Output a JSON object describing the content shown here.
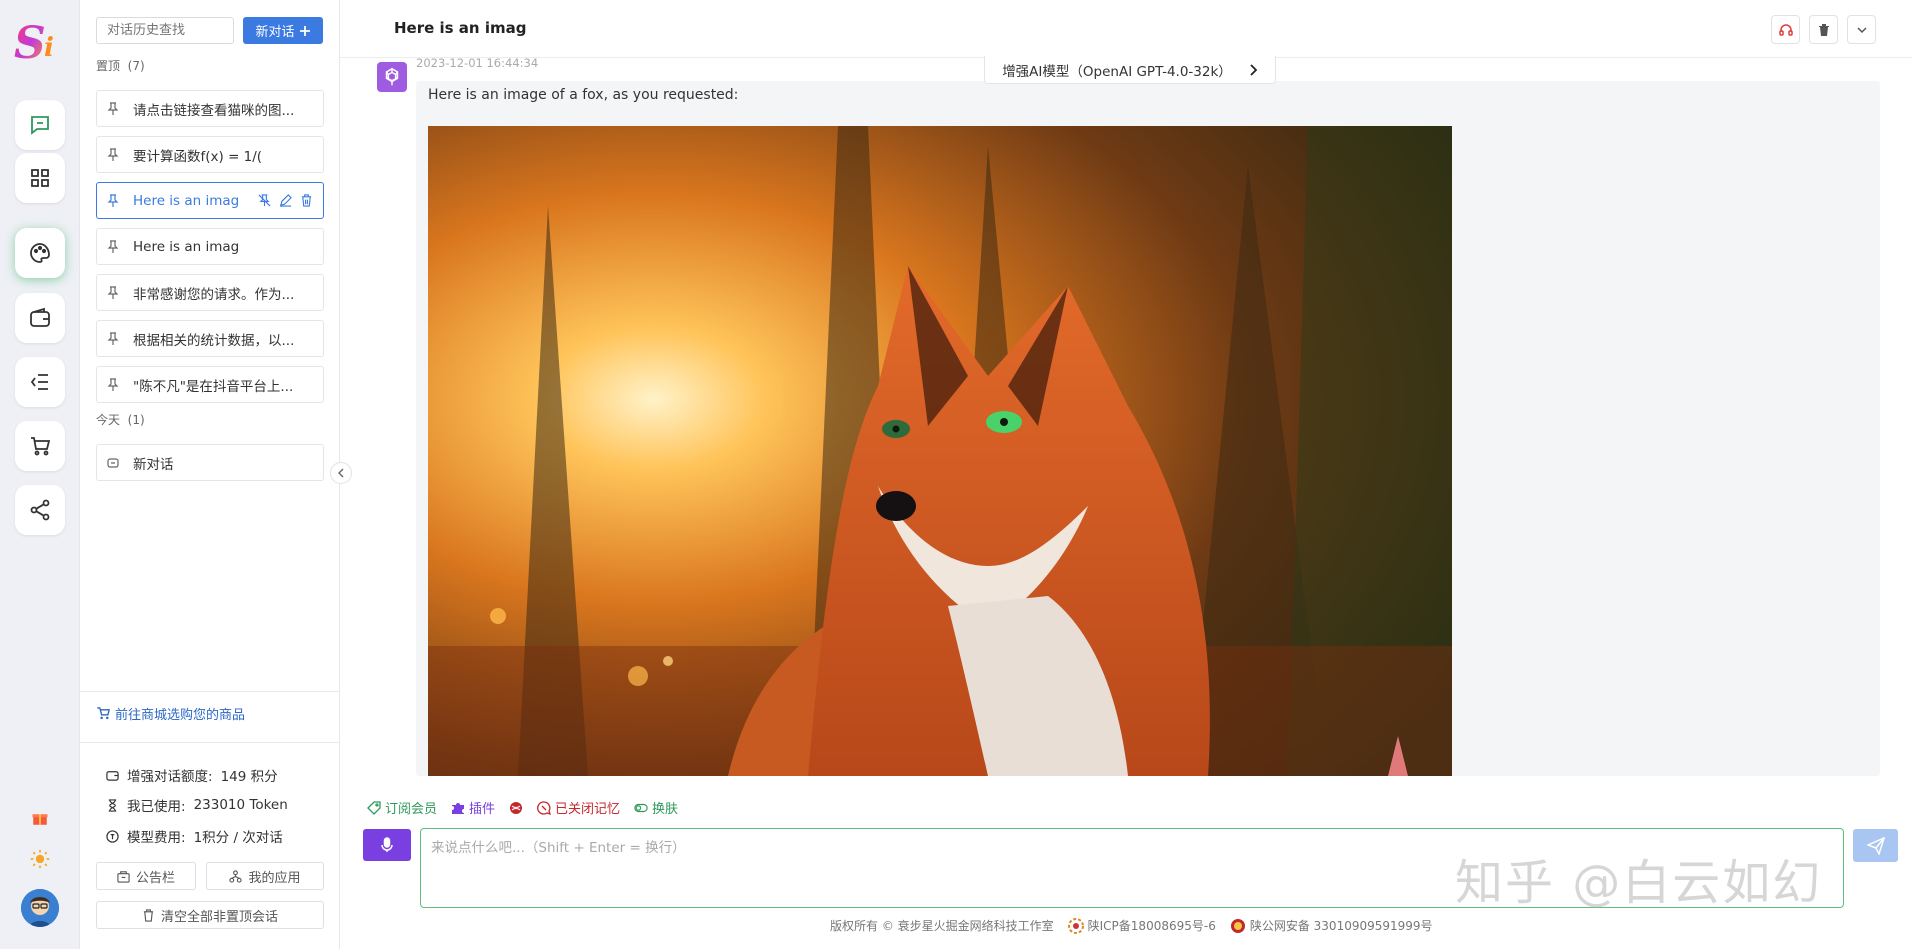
{
  "colors": {
    "accent": "#3b7ae0",
    "active_rail_glow": "#40b46e",
    "input_border": "#5bbf7a",
    "mic": "#7a3fe0",
    "bot": "#a05ce0"
  },
  "rail": {
    "logo_text": "Si",
    "items": [
      {
        "icon": "chat-icon"
      },
      {
        "icon": "apps-grid-icon"
      },
      {
        "icon": "palette-icon"
      },
      {
        "icon": "wallet-icon"
      },
      {
        "icon": "menu-list-icon"
      },
      {
        "icon": "cart-icon"
      },
      {
        "icon": "share-icon"
      }
    ],
    "extras": [
      {
        "icon": "gift-icon"
      },
      {
        "icon": "sun-icon"
      },
      {
        "icon": "user-avatar"
      }
    ]
  },
  "sidebar": {
    "search_placeholder": "对话历史查找",
    "new_chat_label": "新对话",
    "pinned_label": "置顶",
    "pinned_count": "(7)",
    "pinned_items": [
      {
        "label": "请点击链接查看猫咪的图..."
      },
      {
        "label": "要计算函数f(x) = 1/("
      },
      {
        "label": "Here is an imag"
      },
      {
        "label": "Here is an imag"
      },
      {
        "label": "非常感谢您的请求。作为..."
      },
      {
        "label": "根据相关的统计数据，以..."
      },
      {
        "label": "\"陈不凡\"是在抖音平台上..."
      }
    ],
    "today_label": "今天",
    "today_count": "(1)",
    "today_items": [
      {
        "label": "新对话"
      }
    ],
    "shop_link": "前往商城选购您的商品",
    "stats": {
      "quota_label": "增强对话额度:",
      "quota_value": "149 积分",
      "used_label": "我已使用:",
      "used_value": "233010 Token",
      "fee_label": "模型费用:",
      "fee_value": "1积分 / 次对话"
    },
    "notice_button": "公告栏",
    "apps_button": "我的应用",
    "clear_button": "清空全部非置顶会话"
  },
  "chat": {
    "title": "Here is an imag",
    "model_tag": "增强AI模型（OpenAI GPT-4.0-32k）",
    "timestamp": "2023-12-01 16:44:34",
    "message": "Here is an image of a fox, as you requested:"
  },
  "toolbar": {
    "subscribe": "订阅会员",
    "plugins": "插件",
    "memory_off": "已关闭记忆",
    "skin": "换肤"
  },
  "input": {
    "placeholder": "来说点什么吧...（Shift + Enter = 换行）"
  },
  "watermark": "知乎 @白云如幻",
  "footer": {
    "copyright": "版权所有 © 衰步星火掘金网络科技工作室",
    "icp": "陕ICP备18008695号-6",
    "police": "陕公网安备 33010909591999号"
  }
}
